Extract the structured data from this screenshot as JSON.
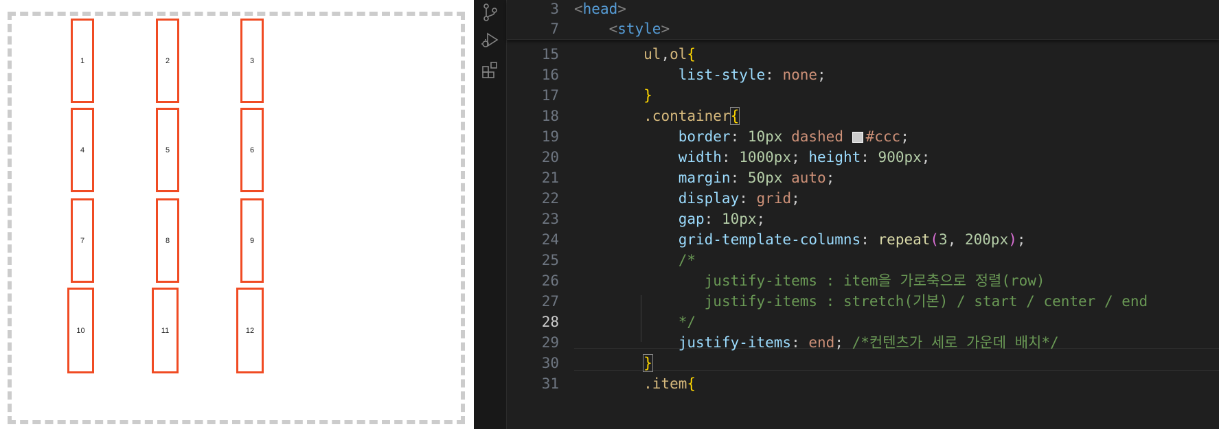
{
  "preview": {
    "items": [
      {
        "label": "1"
      },
      {
        "label": "2"
      },
      {
        "label": "3"
      },
      {
        "label": "4"
      },
      {
        "label": "5"
      },
      {
        "label": "6"
      },
      {
        "label": "7"
      },
      {
        "label": "8"
      },
      {
        "label": "9"
      },
      {
        "label": "10"
      },
      {
        "label": "11"
      },
      {
        "label": "12"
      }
    ],
    "item_border_color": "#f04b23",
    "container_border_color": "#cccccc"
  },
  "activity_bar": {
    "icons": [
      "source-control-icon",
      "run-debug-icon",
      "extensions-icon"
    ]
  },
  "editor": {
    "sticky": [
      {
        "ln": "3",
        "tokens": [
          [
            "t-br",
            "<"
          ],
          [
            "t-tag",
            "head"
          ],
          [
            "t-br",
            ">"
          ]
        ]
      },
      {
        "ln": "7",
        "tokens": [
          [
            "",
            "    "
          ],
          [
            "t-br",
            "<"
          ],
          [
            "t-tag",
            "style"
          ],
          [
            "t-br",
            ">"
          ]
        ]
      }
    ],
    "lines": [
      {
        "ln": "15",
        "tokens": [
          [
            "",
            "        "
          ],
          [
            "t-sel",
            "ul"
          ],
          [
            "",
            ","
          ],
          [
            "t-sel",
            "ol"
          ],
          [
            "t-gold",
            "{"
          ]
        ]
      },
      {
        "ln": "16",
        "tokens": [
          [
            "",
            "            "
          ],
          [
            "t-prop",
            "list-style"
          ],
          [
            "",
            ": "
          ],
          [
            "t-val",
            "none"
          ],
          [
            "",
            ";"
          ]
        ]
      },
      {
        "ln": "17",
        "tokens": [
          [
            "",
            "        "
          ],
          [
            "t-gold",
            "}"
          ]
        ]
      },
      {
        "ln": "18",
        "tokens": [
          [
            "",
            "        "
          ],
          [
            "t-sel",
            ".container"
          ],
          [
            "t-gold t-boxed",
            "{"
          ]
        ]
      },
      {
        "ln": "19",
        "tokens": [
          [
            "",
            "            "
          ],
          [
            "t-prop",
            "border"
          ],
          [
            "",
            ": "
          ],
          [
            "t-num",
            "10px"
          ],
          [
            "",
            " "
          ],
          [
            "t-val",
            "dashed"
          ],
          [
            "",
            " "
          ],
          [
            "swatch",
            ""
          ],
          [
            "t-val",
            "#ccc"
          ],
          [
            "",
            ";"
          ]
        ]
      },
      {
        "ln": "20",
        "tokens": [
          [
            "",
            "            "
          ],
          [
            "t-prop",
            "width"
          ],
          [
            "",
            ": "
          ],
          [
            "t-num",
            "1000px"
          ],
          [
            "",
            "; "
          ],
          [
            "t-prop",
            "height"
          ],
          [
            "",
            ": "
          ],
          [
            "t-num",
            "900px"
          ],
          [
            "",
            ";"
          ]
        ]
      },
      {
        "ln": "21",
        "tokens": [
          [
            "",
            "            "
          ],
          [
            "t-prop",
            "margin"
          ],
          [
            "",
            ": "
          ],
          [
            "t-num",
            "50px"
          ],
          [
            "",
            " "
          ],
          [
            "t-val",
            "auto"
          ],
          [
            "",
            ";"
          ]
        ]
      },
      {
        "ln": "22",
        "tokens": [
          [
            "",
            "            "
          ],
          [
            "t-prop",
            "display"
          ],
          [
            "",
            ": "
          ],
          [
            "t-val",
            "grid"
          ],
          [
            "",
            ";"
          ]
        ]
      },
      {
        "ln": "23",
        "tokens": [
          [
            "",
            "            "
          ],
          [
            "t-prop",
            "gap"
          ],
          [
            "",
            ": "
          ],
          [
            "t-num",
            "10px"
          ],
          [
            "",
            ";"
          ]
        ]
      },
      {
        "ln": "24",
        "tokens": [
          [
            "",
            "            "
          ],
          [
            "t-prop",
            "grid-template-columns"
          ],
          [
            "",
            ": "
          ],
          [
            "t-fn",
            "repeat"
          ],
          [
            "t-pink",
            "("
          ],
          [
            "t-num",
            "3"
          ],
          [
            "",
            ", "
          ],
          [
            "t-num",
            "200px"
          ],
          [
            "t-pink",
            ")"
          ],
          [
            "",
            ";"
          ]
        ]
      },
      {
        "ln": "25",
        "tokens": [
          [
            "",
            "            "
          ],
          [
            "t-com",
            "/*"
          ]
        ]
      },
      {
        "ln": "26",
        "tokens": [
          [
            "",
            "               "
          ],
          [
            "t-com",
            "justify-items : item을 가로축으로 정렬(row)"
          ]
        ]
      },
      {
        "ln": "27",
        "tokens": [
          [
            "",
            "               "
          ],
          [
            "t-com",
            "justify-items : stretch(기본) / start / center / end"
          ]
        ]
      },
      {
        "ln": "28",
        "tokens": [
          [
            "",
            "            "
          ],
          [
            "t-com",
            "*/"
          ]
        ]
      },
      {
        "ln": "29",
        "tokens": [
          [
            "",
            "            "
          ],
          [
            "t-prop",
            "justify-items"
          ],
          [
            "",
            ": "
          ],
          [
            "t-val",
            "end"
          ],
          [
            "",
            "; "
          ],
          [
            "t-com",
            "/*컨텐츠가 세로 가운데 배치*/"
          ]
        ]
      },
      {
        "ln": "30",
        "tokens": [
          [
            "",
            "        "
          ],
          [
            "t-gold t-boxed",
            "}"
          ]
        ]
      },
      {
        "ln": "31",
        "tokens": [
          [
            "",
            "        "
          ],
          [
            "t-sel",
            ".item"
          ],
          [
            "t-gold",
            "{"
          ]
        ]
      }
    ],
    "active_line": "28"
  }
}
